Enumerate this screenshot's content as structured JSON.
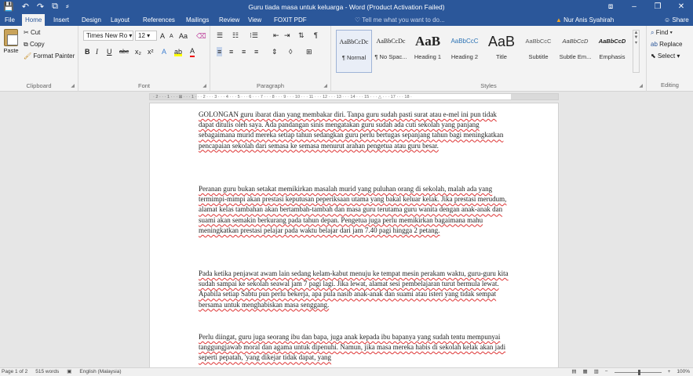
{
  "window": {
    "title": "Guru tiada masa untuk keluarga - Word (Product Activation Failed)",
    "qat_save": "💾",
    "qat_undo": "↶",
    "qat_redo": "↷",
    "qat_extra": "⧉",
    "qat_more": "⸗",
    "ribbon_display": "⧈",
    "minimize": "–",
    "maximize": "❐",
    "close": "✕"
  },
  "tabs": [
    "File",
    "Home",
    "Insert",
    "Design",
    "Layout",
    "References",
    "Mailings",
    "Review",
    "View",
    "FOXIT PDF"
  ],
  "tell_me": "Tell me what you want to do...",
  "user": "Nur Anis Syahirah",
  "share": "Share",
  "clipboard": {
    "paste": "Paste",
    "cut": "Cut",
    "copy": "Copy",
    "format_painter": "Format Painter",
    "label": "Clipboard"
  },
  "font": {
    "family": "Times New Ro",
    "size": "12",
    "grow": "A",
    "shrink": "A",
    "case": "Aa",
    "clear": "⌫",
    "bold": "B",
    "italic": "I",
    "underline": "U",
    "strike": "abc",
    "subscript": "x₂",
    "superscript": "x²",
    "effects": "A",
    "highlight": "ab",
    "color": "A",
    "label": "Font"
  },
  "paragraph": {
    "bullets": "☰",
    "numbering": "☷",
    "multilevel": "⁝☰",
    "decrease": "⇤",
    "increase": "⇥",
    "sort": "⇅",
    "marks": "¶",
    "left": "≡",
    "center": "≡",
    "right": "≡",
    "justify": "≡",
    "spacing": "⇕",
    "shading": "◊",
    "borders": "⊞",
    "label": "Paragraph"
  },
  "styles": {
    "items": [
      {
        "preview": "AaBbCcDc",
        "name": "¶ Normal"
      },
      {
        "preview": "AaBbCcDc",
        "name": "¶ No Spac..."
      },
      {
        "preview": "AaB",
        "name": "Heading 1"
      },
      {
        "preview": "AaBbCcC",
        "name": "Heading 2"
      },
      {
        "preview": "AaB",
        "name": "Title"
      },
      {
        "preview": "AaBbCcC",
        "name": "Subtitle"
      },
      {
        "preview": "AaBbCcD",
        "name": "Subtle Em..."
      },
      {
        "preview": "AaBbCcD",
        "name": "Emphasis"
      }
    ],
    "label": "Styles"
  },
  "editing": {
    "find": "Find",
    "replace": "Replace",
    "select": "Select",
    "label": "Editing"
  },
  "ruler": "· 2 · · · 1 · · · ⊠ · · · 1 · · · 2 · · · 3 · · · 4 · · · 5 · · · 6 · · · 7 · · · 8 · · · 9 · · · 10 · · · 11 · · · 12 · · · 13 · · · 14 · · · 15 · · · △ · · · 17 · · · 18 ·",
  "document": {
    "paragraphs": [
      "GOLONGAN guru ibarat dian yang membakar diri. Tanpa guru sudah pasti surat atau e-mel ini pun tidak dapat ditulis oleh saya. Ada pandangan sinis mengatakan guru sudah ada cuti sekolah yang panjang sebagaimana murid mereka setiap tahun sedangkan guru perlu bertugas sepanjang tahun bagi meningkatkan pencapaian sekolah dari semasa ke semasa menurut arahan pengetua atau guru besar.",
      "Peranan guru bukan setakat memikirkan masalah murid yang puluhan orang di sekolah, malah ada yang termimpi-mimpi akan prestasi keputusan peperiksaan utama yang bakal keluar kelak. Jika prestasi merudum, alamat kelas tambahan akan bertambah-tambah dan masa guru terutama guru wanita dengan anak-anak dan suami akan semakin berkurang pada tahun depan. Pengetua juga perlu memikirkan bagaimana mahu meningkatkan prestasi pelajar pada waktu belajar dari jam 7.40 pagi hingga 2 petang.",
      "Pada ketika penjawat awam lain sedang kelam-kabut menuju ke tempat mesin perakam waktu, guru-guru kita sudah sampai ke sekolah seawal jam 7 pagi lagi. Jika lewat, alamat sesi pembelajaran turut bermula lewat. Apabila setiap Sabtu pun perlu bekerja, apa pula nasib anak-anak dan suami atau isteri yang tidak sempat bersama untuk menghabiskan masa senggang.",
      "Perlu diingat, guru juga seorang ibu dan bapa, juga anak kepada ibu bapanya yang sudah tentu mempunyai tanggungjawab moral dan agama untuk dipenuhi. Namun, jika masa mereka habis di sekolah kelak akan jadi seperti pepatah, 'yang dikejar tidak dapat, yang"
    ]
  },
  "status": {
    "page": "Page 1 of 2",
    "words": "515 words",
    "language": "English (Malaysia)",
    "zoom": "100%"
  },
  "colors": {
    "accent": "#2b579a",
    "spell_underline": "#dd3333",
    "warning": "#f5a623"
  }
}
